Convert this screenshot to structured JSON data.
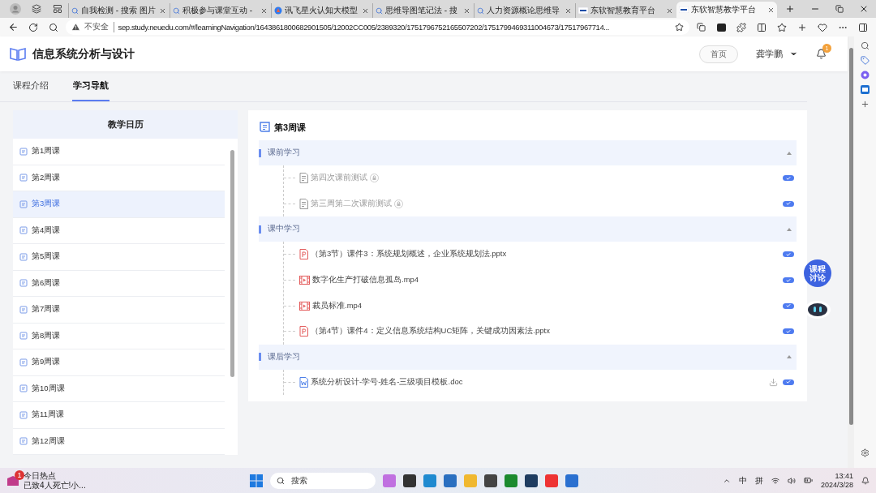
{
  "browser": {
    "tabs": [
      {
        "title": "自我检测 - 搜索 图片",
        "kind": "search",
        "selected": false
      },
      {
        "title": "积极参与课堂互动 -",
        "kind": "search",
        "selected": false
      },
      {
        "title": "讯飞星火认知大模型",
        "kind": "spark",
        "selected": false
      },
      {
        "title": "思维导图笔记法 - 搜",
        "kind": "search",
        "selected": false
      },
      {
        "title": "人力资源概论思维导",
        "kind": "search",
        "selected": false
      },
      {
        "title": "东软智慧教育平台",
        "kind": "neu",
        "selected": false
      },
      {
        "title": "东软智慧教学平台",
        "kind": "neu",
        "selected": true
      }
    ],
    "address": {
      "security": "不安全",
      "url": "sep.study.neuedu.com/#/learningNavigation/1643861800682901505/12002CC005/2389320/1751796752165507202/1751799469311004673/17517967714..."
    }
  },
  "header": {
    "title": "信息系统分析与设计",
    "home_button": "首页",
    "user": "龚学鹏",
    "notification_badge": "1"
  },
  "nav_tabs": [
    {
      "label": "课程介绍",
      "selected": false
    },
    {
      "label": "学习导航",
      "selected": true
    }
  ],
  "calendar": {
    "title": "教学日历",
    "weeks": [
      {
        "label": "第1周课",
        "selected": false
      },
      {
        "label": "第2周课",
        "selected": false
      },
      {
        "label": "第3周课",
        "selected": true
      },
      {
        "label": "第4周课",
        "selected": false
      },
      {
        "label": "第5周课",
        "selected": false
      },
      {
        "label": "第6周课",
        "selected": false
      },
      {
        "label": "第7周课",
        "selected": false
      },
      {
        "label": "第8周课",
        "selected": false
      },
      {
        "label": "第9周课",
        "selected": false
      },
      {
        "label": "第10周课",
        "selected": false
      },
      {
        "label": "第11周课",
        "selected": false
      },
      {
        "label": "第12周课",
        "selected": false
      }
    ]
  },
  "week": {
    "title": "第3周课",
    "sections": [
      {
        "title": "课前学习",
        "expanded": true,
        "items": [
          {
            "kind": "quiz",
            "name": "第四次课前测试",
            "locked": true,
            "done": true,
            "downloadable": false
          },
          {
            "kind": "quiz",
            "name": "第三周第二次课前测试",
            "locked": true,
            "done": true,
            "downloadable": false
          }
        ]
      },
      {
        "title": "课中学习",
        "expanded": true,
        "items": [
          {
            "kind": "ppt",
            "name": "（第3节）课件3：系统规划概述，企业系统规划法.pptx",
            "locked": false,
            "done": true,
            "downloadable": false
          },
          {
            "kind": "video",
            "name": "数字化生产打破信息孤岛.mp4",
            "locked": false,
            "done": true,
            "downloadable": false
          },
          {
            "kind": "video",
            "name": "裁员标准.mp4",
            "locked": false,
            "done": true,
            "downloadable": false
          },
          {
            "kind": "ppt",
            "name": "（第4节）课件4：定义信息系统结构UC矩阵，关键成功因素法.pptx",
            "locked": false,
            "done": true,
            "downloadable": false
          }
        ]
      },
      {
        "title": "课后学习",
        "expanded": true,
        "items": [
          {
            "kind": "doc",
            "name": "系统分析设计-学号-姓名-三级项目模板.doc",
            "locked": false,
            "done": true,
            "downloadable": true
          }
        ]
      }
    ]
  },
  "float_buttons": {
    "discuss": "课程讨论"
  },
  "taskbar": {
    "news": {
      "title": "今日热点",
      "text": "已致4人死亡!小...",
      "badge": "1"
    },
    "search": "搜索",
    "tray": [
      "中",
      "拼"
    ],
    "time": "13:41",
    "date": "2024/3/28"
  }
}
